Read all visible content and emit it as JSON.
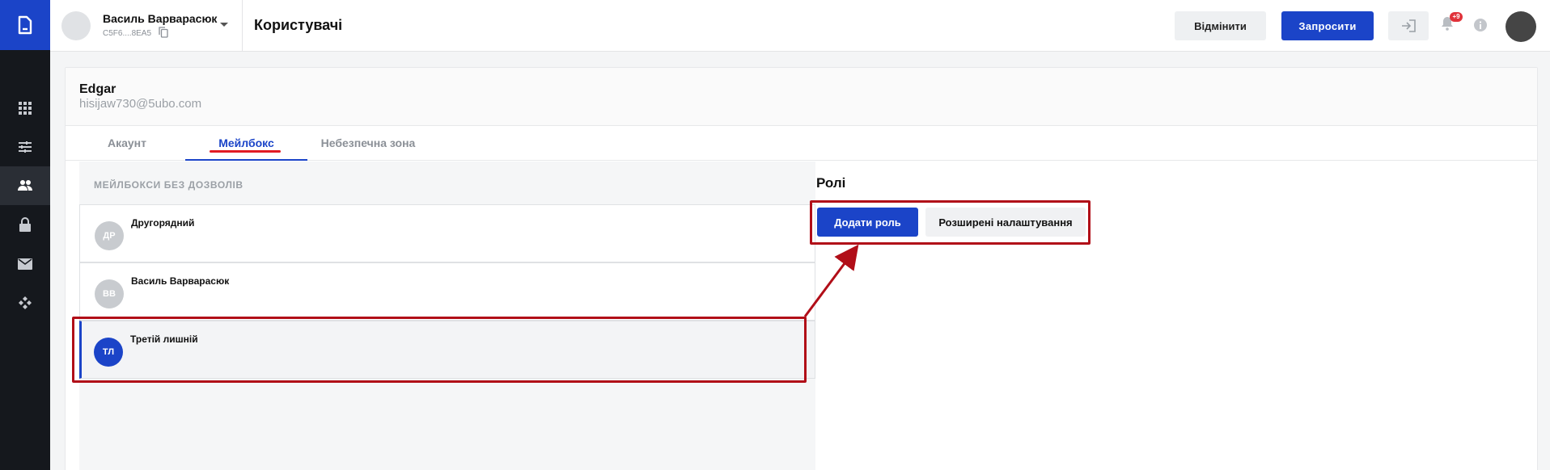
{
  "app": {
    "logo_icon": "document-icon",
    "nav": [
      {
        "icon": "apps-grid-icon",
        "active": false
      },
      {
        "icon": "sliders-icon",
        "active": false
      },
      {
        "icon": "users-icon",
        "active": true
      },
      {
        "icon": "lock-icon",
        "active": false
      },
      {
        "icon": "mail-icon",
        "active": false
      },
      {
        "icon": "integrations-icon",
        "active": false
      }
    ]
  },
  "header": {
    "account_name": "Василь Варварасюк",
    "account_code": "C5F6....8EA5",
    "page_title": "Користувачі",
    "cancel_label": "Відмінити",
    "invite_label": "Запросити",
    "notification_count": "+9"
  },
  "user": {
    "name": "Edgar",
    "email": "hisijaw730@5ubo.com"
  },
  "tabs": [
    {
      "label": "Акаунт",
      "active": false
    },
    {
      "label": "Мейлбокс",
      "active": true
    },
    {
      "label": "Небезпечна зона",
      "active": false
    }
  ],
  "mailboxes": {
    "section_title": "МЕЙЛБОКСИ БЕЗ ДОЗВОЛІВ",
    "items": [
      {
        "initials": "ДР",
        "name": "Другорядний",
        "selected": false
      },
      {
        "initials": "ВВ",
        "name": "Василь Варварасюк",
        "selected": false
      },
      {
        "initials": "ТЛ",
        "name": "Третій лишній",
        "selected": true
      }
    ]
  },
  "roles": {
    "title": "Ролі",
    "add_role_label": "Додати роль",
    "advanced_label": "Розширені налаштування"
  },
  "colors": {
    "accent": "#1b44c8",
    "annotation": "#b10e18",
    "rail": "#15181d"
  }
}
